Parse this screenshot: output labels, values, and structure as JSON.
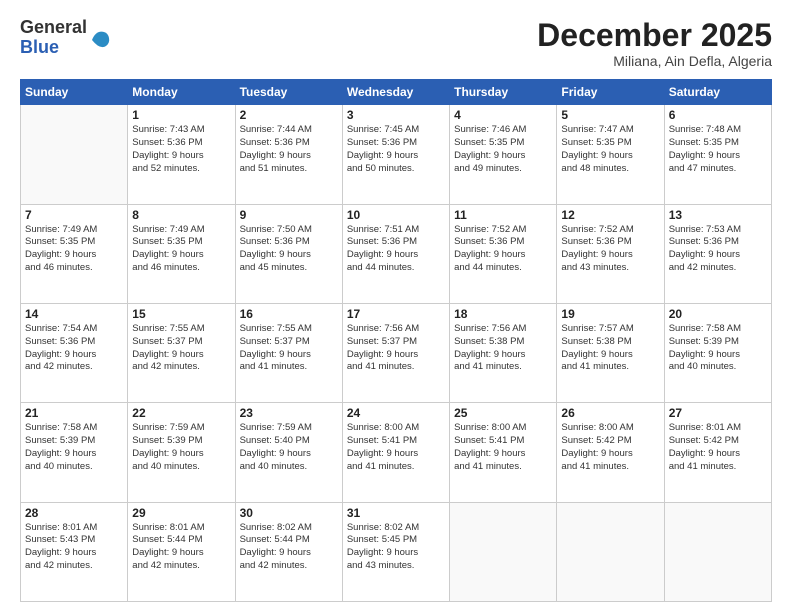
{
  "header": {
    "logo_general": "General",
    "logo_blue": "Blue",
    "month_title": "December 2025",
    "location": "Miliana, Ain Defla, Algeria"
  },
  "days_of_week": [
    "Sunday",
    "Monday",
    "Tuesday",
    "Wednesday",
    "Thursday",
    "Friday",
    "Saturday"
  ],
  "weeks": [
    [
      {
        "day": "",
        "info": ""
      },
      {
        "day": "1",
        "info": "Sunrise: 7:43 AM\nSunset: 5:36 PM\nDaylight: 9 hours\nand 52 minutes."
      },
      {
        "day": "2",
        "info": "Sunrise: 7:44 AM\nSunset: 5:36 PM\nDaylight: 9 hours\nand 51 minutes."
      },
      {
        "day": "3",
        "info": "Sunrise: 7:45 AM\nSunset: 5:36 PM\nDaylight: 9 hours\nand 50 minutes."
      },
      {
        "day": "4",
        "info": "Sunrise: 7:46 AM\nSunset: 5:35 PM\nDaylight: 9 hours\nand 49 minutes."
      },
      {
        "day": "5",
        "info": "Sunrise: 7:47 AM\nSunset: 5:35 PM\nDaylight: 9 hours\nand 48 minutes."
      },
      {
        "day": "6",
        "info": "Sunrise: 7:48 AM\nSunset: 5:35 PM\nDaylight: 9 hours\nand 47 minutes."
      }
    ],
    [
      {
        "day": "7",
        "info": "Sunrise: 7:49 AM\nSunset: 5:35 PM\nDaylight: 9 hours\nand 46 minutes."
      },
      {
        "day": "8",
        "info": "Sunrise: 7:49 AM\nSunset: 5:35 PM\nDaylight: 9 hours\nand 46 minutes."
      },
      {
        "day": "9",
        "info": "Sunrise: 7:50 AM\nSunset: 5:36 PM\nDaylight: 9 hours\nand 45 minutes."
      },
      {
        "day": "10",
        "info": "Sunrise: 7:51 AM\nSunset: 5:36 PM\nDaylight: 9 hours\nand 44 minutes."
      },
      {
        "day": "11",
        "info": "Sunrise: 7:52 AM\nSunset: 5:36 PM\nDaylight: 9 hours\nand 44 minutes."
      },
      {
        "day": "12",
        "info": "Sunrise: 7:52 AM\nSunset: 5:36 PM\nDaylight: 9 hours\nand 43 minutes."
      },
      {
        "day": "13",
        "info": "Sunrise: 7:53 AM\nSunset: 5:36 PM\nDaylight: 9 hours\nand 42 minutes."
      }
    ],
    [
      {
        "day": "14",
        "info": "Sunrise: 7:54 AM\nSunset: 5:36 PM\nDaylight: 9 hours\nand 42 minutes."
      },
      {
        "day": "15",
        "info": "Sunrise: 7:55 AM\nSunset: 5:37 PM\nDaylight: 9 hours\nand 42 minutes."
      },
      {
        "day": "16",
        "info": "Sunrise: 7:55 AM\nSunset: 5:37 PM\nDaylight: 9 hours\nand 41 minutes."
      },
      {
        "day": "17",
        "info": "Sunrise: 7:56 AM\nSunset: 5:37 PM\nDaylight: 9 hours\nand 41 minutes."
      },
      {
        "day": "18",
        "info": "Sunrise: 7:56 AM\nSunset: 5:38 PM\nDaylight: 9 hours\nand 41 minutes."
      },
      {
        "day": "19",
        "info": "Sunrise: 7:57 AM\nSunset: 5:38 PM\nDaylight: 9 hours\nand 41 minutes."
      },
      {
        "day": "20",
        "info": "Sunrise: 7:58 AM\nSunset: 5:39 PM\nDaylight: 9 hours\nand 40 minutes."
      }
    ],
    [
      {
        "day": "21",
        "info": "Sunrise: 7:58 AM\nSunset: 5:39 PM\nDaylight: 9 hours\nand 40 minutes."
      },
      {
        "day": "22",
        "info": "Sunrise: 7:59 AM\nSunset: 5:39 PM\nDaylight: 9 hours\nand 40 minutes."
      },
      {
        "day": "23",
        "info": "Sunrise: 7:59 AM\nSunset: 5:40 PM\nDaylight: 9 hours\nand 40 minutes."
      },
      {
        "day": "24",
        "info": "Sunrise: 8:00 AM\nSunset: 5:41 PM\nDaylight: 9 hours\nand 41 minutes."
      },
      {
        "day": "25",
        "info": "Sunrise: 8:00 AM\nSunset: 5:41 PM\nDaylight: 9 hours\nand 41 minutes."
      },
      {
        "day": "26",
        "info": "Sunrise: 8:00 AM\nSunset: 5:42 PM\nDaylight: 9 hours\nand 41 minutes."
      },
      {
        "day": "27",
        "info": "Sunrise: 8:01 AM\nSunset: 5:42 PM\nDaylight: 9 hours\nand 41 minutes."
      }
    ],
    [
      {
        "day": "28",
        "info": "Sunrise: 8:01 AM\nSunset: 5:43 PM\nDaylight: 9 hours\nand 42 minutes."
      },
      {
        "day": "29",
        "info": "Sunrise: 8:01 AM\nSunset: 5:44 PM\nDaylight: 9 hours\nand 42 minutes."
      },
      {
        "day": "30",
        "info": "Sunrise: 8:02 AM\nSunset: 5:44 PM\nDaylight: 9 hours\nand 42 minutes."
      },
      {
        "day": "31",
        "info": "Sunrise: 8:02 AM\nSunset: 5:45 PM\nDaylight: 9 hours\nand 43 minutes."
      },
      {
        "day": "",
        "info": ""
      },
      {
        "day": "",
        "info": ""
      },
      {
        "day": "",
        "info": ""
      }
    ]
  ]
}
